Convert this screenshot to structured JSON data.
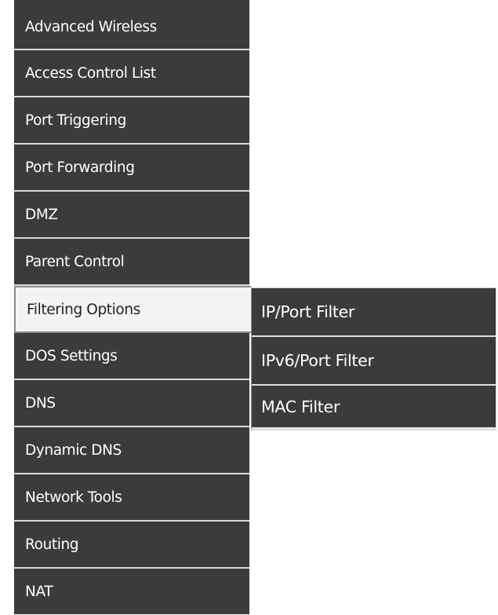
{
  "sidebar": {
    "items": [
      {
        "label": "Advanced Wireless"
      },
      {
        "label": "Access Control List"
      },
      {
        "label": "Port Triggering"
      },
      {
        "label": "Port Forwarding"
      },
      {
        "label": "DMZ"
      },
      {
        "label": "Parent Control"
      },
      {
        "label": "Filtering Options"
      },
      {
        "label": "DOS Settings"
      },
      {
        "label": "DNS"
      },
      {
        "label": "Dynamic DNS"
      },
      {
        "label": "Network Tools"
      },
      {
        "label": "Routing"
      },
      {
        "label": "NAT"
      }
    ],
    "active_item": "Filtering Options"
  },
  "submenu": {
    "items": [
      {
        "label": "IP/Port Filter"
      },
      {
        "label": "IPv6/Port Filter"
      },
      {
        "label": "MAC Filter"
      }
    ]
  },
  "colors": {
    "menu_background": "#3b3b3b",
    "menu_text": "#ffffff",
    "active_background": "#f3f3f3",
    "active_text": "#222222",
    "separator": "#d9d9d9"
  }
}
